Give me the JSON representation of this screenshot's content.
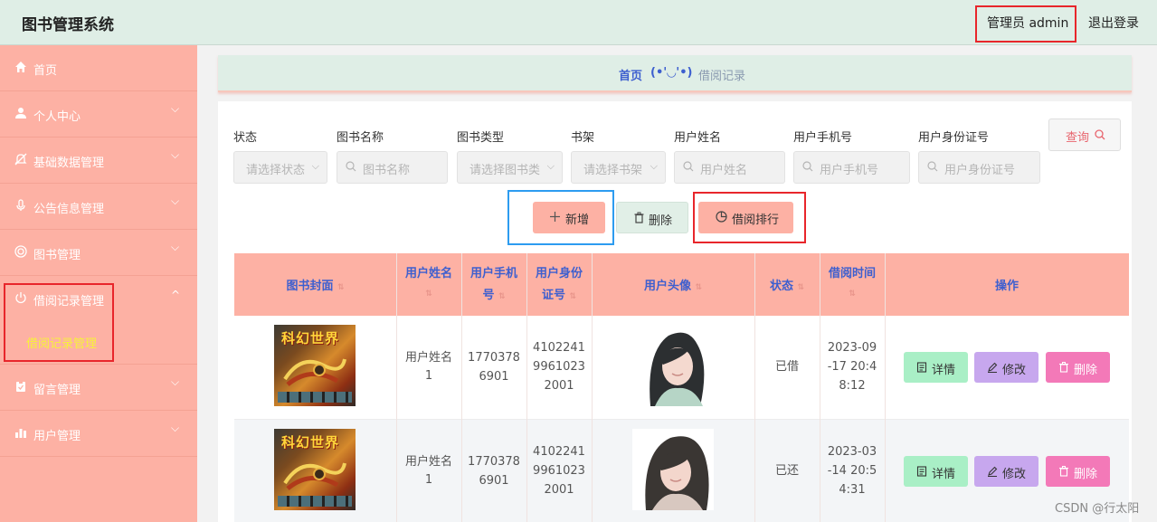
{
  "header": {
    "app_title": "图书管理系统",
    "admin_label": "管理员 admin",
    "logout_label": "退出登录"
  },
  "sidebar": {
    "items": [
      {
        "label": "首页",
        "icon": "home-icon"
      },
      {
        "label": "个人中心",
        "icon": "user-icon"
      },
      {
        "label": "基础数据管理",
        "icon": "bell-off-icon"
      },
      {
        "label": "公告信息管理",
        "icon": "microphone-icon"
      },
      {
        "label": "图书管理",
        "icon": "target-icon"
      },
      {
        "label": "借阅记录管理",
        "icon": "power-icon"
      },
      {
        "label": "留言管理",
        "icon": "clipboard-icon"
      },
      {
        "label": "用户管理",
        "icon": "bar-chart-icon"
      }
    ],
    "active_sub": "借阅记录管理",
    "sub_color": "#f7f23a"
  },
  "breadcrumb": {
    "home": "首页",
    "separator": "(•'◡'•)",
    "current": "借阅记录"
  },
  "filters": {
    "status": {
      "label": "状态",
      "placeholder": "请选择状态"
    },
    "book_name": {
      "label": "图书名称",
      "placeholder": "图书名称"
    },
    "book_type": {
      "label": "图书类型",
      "placeholder": "请选择图书类"
    },
    "shelf": {
      "label": "书架",
      "placeholder": "请选择书架"
    },
    "user_name": {
      "label": "用户姓名",
      "placeholder": "用户姓名"
    },
    "user_phone": {
      "label": "用户手机号",
      "placeholder": "用户手机号"
    },
    "user_id_card": {
      "label": "用户身份证号",
      "placeholder": "用户身份证号"
    },
    "query_label": "查询"
  },
  "actions": {
    "add_label": "新增",
    "delete_label": "删除",
    "ranking_label": "借阅排行"
  },
  "table": {
    "columns": {
      "cover": "图书封面",
      "name_1": "用户姓名",
      "phone_1": "用户手机",
      "phone_2": "号",
      "idcard_1": "用户身份",
      "idcard_2": "证号",
      "avatar": "用户头像",
      "status": "状态",
      "time": "借阅时间",
      "ops": "操作"
    },
    "rows": [
      {
        "cover_text": "科幻世界",
        "name": [
          "用户姓名",
          "1"
        ],
        "phone": [
          "1770378",
          "6901"
        ],
        "idcard": [
          "4102241",
          "9961023",
          "2001"
        ],
        "status": "已借",
        "time": [
          "2023-09",
          "-17 20:4",
          "8:12"
        ]
      },
      {
        "cover_text": "科幻世界",
        "name": [
          "用户姓名",
          "1"
        ],
        "phone": [
          "1770378",
          "6901"
        ],
        "idcard": [
          "4102241",
          "9961023",
          "2001"
        ],
        "status": "已还",
        "time": [
          "2023-03",
          "-14 20:5",
          "4:31"
        ]
      }
    ],
    "ops": {
      "detail": "详情",
      "edit": "修改",
      "delete": "删除"
    }
  },
  "colors": {
    "header_bg": "#dfeee6",
    "sidebar_bg": "#fdb1a4",
    "accent_blue": "#3d5fcf",
    "detail_bg": "#a9efc6",
    "edit_bg": "#c7a7ee",
    "delete_bg": "#f379b8"
  },
  "watermark": "CSDN @行太阳"
}
